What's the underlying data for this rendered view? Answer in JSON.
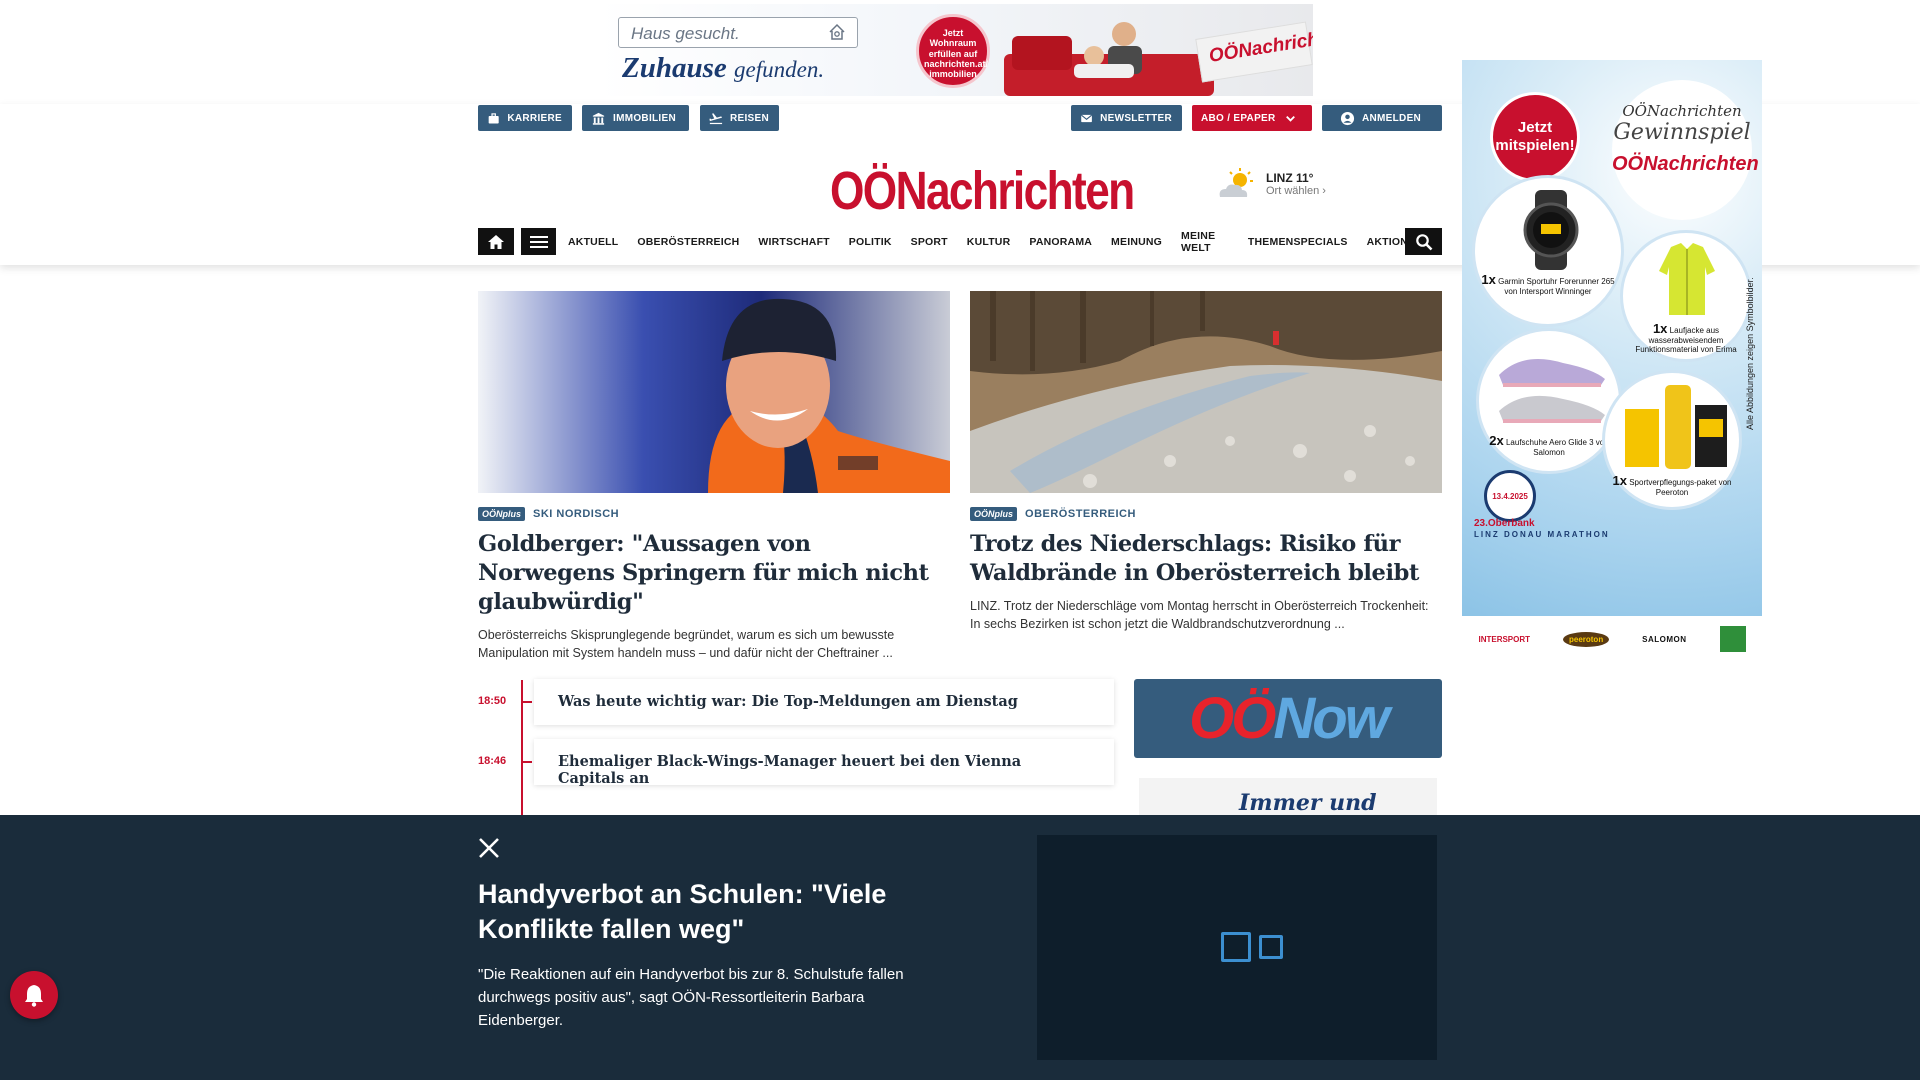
{
  "top_ad": {
    "search_text": "Haus gesucht.",
    "slogan_main": "Zuhause",
    "slogan_rest": "gefunden.",
    "badge_text": "Jetzt Wohnraum erfüllen auf nachrichten.at/ immobilien",
    "paper_logo": "OÖNachrichten"
  },
  "utility": {
    "karriere": "KARRIERE",
    "immobilien": "IMMOBILIEN",
    "reisen": "REISEN",
    "newsletter": "NEWSLETTER",
    "abo": "ABO / EPAPER",
    "anmelden": "ANMELDEN"
  },
  "logo": "OÖNachrichten",
  "weather": {
    "city_temp": "LINZ 11°",
    "choose": "Ort wählen",
    "icon": "partly-cloudy-icon"
  },
  "nav": {
    "items": [
      "AKTUELL",
      "OBERÖSTERREICH",
      "WIRTSCHAFT",
      "POLITIK",
      "SPORT",
      "KULTUR",
      "PANORAMA",
      "MEINUNG",
      "MEINE WELT",
      "THEMENSPECIALS",
      "AKTIONEN"
    ]
  },
  "articles": [
    {
      "badge": "OÖNplus",
      "kicker": "SKI NORDISCH",
      "title": "Goldberger: \"Aussagen von Norwegens Springern für mich nicht glaubwürdig\"",
      "teaser": "Oberösterreichs Skisprunglegende begründet, warum es sich um bewusste Manipulation mit System handeln muss – und dafür nicht der Cheftrainer ..."
    },
    {
      "badge": "OÖNplus",
      "kicker": "OBERÖSTERREICH",
      "title": "Trotz des Niederschlags: Risiko für Waldbrände in Oberösterreich bleibt",
      "teaser": "LINZ. Trotz der Niederschläge vom Montag herrscht in Oberösterreich Trockenheit: In sechs Bezirken ist schon jetzt die Waldbrandschutzverordnung ..."
    }
  ],
  "ticker": [
    {
      "time": "18:50",
      "title": "Was heute wichtig war: Die Top-Meldungen am Dienstag"
    },
    {
      "time": "18:46",
      "title": "Ehemaliger Black-Wings-Manager heuert bei den Vienna Capitals an"
    }
  ],
  "oonow": {
    "o": "OÖ",
    "now": "Now"
  },
  "immer": "Immer und überall",
  "side_ad": {
    "jetzt": "Jetzt mitspielen!",
    "brand_top": "OÖNachrichten",
    "gewinnspiel": "Gewinnspiel",
    "paper": "OÖNachrichten",
    "prizes": [
      {
        "qty": "1x",
        "text": "Garmin Sportuhr Forerunner 265 von Intersport Winninger"
      },
      {
        "qty": "1x",
        "text": "Laufjacke aus wasserabweisendem Funktionsmaterial von Erima"
      },
      {
        "qty": "2x",
        "text": "Laufschuhe Aero Glide 3 von Salomon"
      },
      {
        "qty": "1x",
        "text": "Sportverpflegungs-paket von Peeroton"
      }
    ],
    "date": "13.4.2025",
    "marathon": "23.Oberbank",
    "marathon_sub": "LINZ DONAU MARATHON",
    "disclaimer": "Alle Abbildungen zeigen Symbolbilder.",
    "sponsors": [
      "INTERSPORT",
      "peeroton",
      "SALOMON"
    ]
  },
  "overlay": {
    "title": "Handyverbot an Schulen: \"Viele Konflikte fallen weg\"",
    "teaser": "\"Die Reaktionen auf ein Handyverbot bis zur 8. Schulstufe fallen durchwegs positiv aus\", sagt OÖN-Ressortleiterin Barbara Eidenberger."
  },
  "colors": {
    "brand_red": "#c8102e",
    "brand_blue": "#355c7d",
    "overlay_bg": "#1a2c3b"
  }
}
